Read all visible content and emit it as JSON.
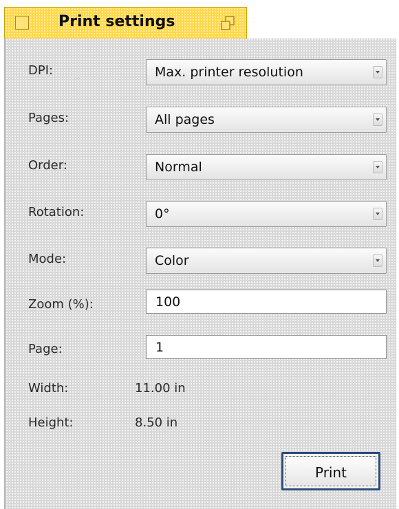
{
  "window": {
    "title": "Print settings"
  },
  "fields": {
    "dpi": {
      "label": "DPI:",
      "value": "Max. printer resolution"
    },
    "pages": {
      "label": "Pages:",
      "value": "All pages"
    },
    "order": {
      "label": "Order:",
      "value": "Normal"
    },
    "rotation": {
      "label": "Rotation:",
      "value": "0°"
    },
    "mode": {
      "label": "Mode:",
      "value": "Color"
    },
    "zoom": {
      "label": "Zoom (%):",
      "value": "100"
    },
    "page": {
      "label": "Page:",
      "value": "1"
    },
    "width": {
      "label": "Width:",
      "value": "11.00 in"
    },
    "height": {
      "label": "Height:",
      "value": "8.50 in"
    }
  },
  "buttons": {
    "print_label": "Print"
  },
  "icons": {
    "close": "close-box-icon",
    "zoom": "zoom-window-icon",
    "dropdown": "dropdown-arrow-icon"
  },
  "colors": {
    "tab": "#ffd84a",
    "panel": "#d8d8d8",
    "button_focus": "#2b4c7a"
  }
}
